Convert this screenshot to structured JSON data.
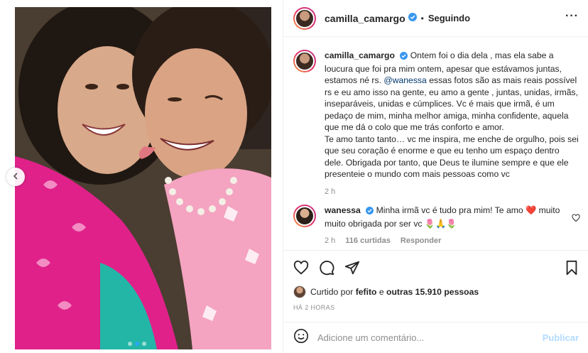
{
  "post": {
    "author": "camilla_camargo",
    "follow_status": "Seguindo",
    "separator": "•",
    "more_icon": "more-horizontal-icon"
  },
  "caption": {
    "username": "camilla_camargo",
    "text_1": "Ontem foi o dia dela , mas ela sabe a loucura que foi pra mim ontem, apesar que estávamos juntas, estamos né rs.",
    "mention": "@wanessa",
    "text_2": "essas fotos são as mais reais possível rs e eu amo isso na gente, eu amo a gente , juntas, unidas, irmãs, inseparáveis, unidas e cúmplices. Vc é mais que irmã, é um pedaço de mim, minha melhor amiga, minha confidente, aquela que me dá o colo que me trás conforto e amor.",
    "text_3": "Te amo tanto tanto… vc me inspira, me enche de orgulho, pois sei que seu coração é enorme e que eu tenho um espaço dentro dele. Obrigada por tanto, que Deus te ilumine sempre e que ele presenteie o mundo com mais pessoas como vc",
    "time": "2 h"
  },
  "reply": {
    "username": "wanessa",
    "text": "Minha irmã vc é tudo pra mim! Te amo ❤️ muito muito obrigada por ser vc 🌷🙏🌷",
    "time": "2 h",
    "likes": "116 curtidas",
    "reply_label": "Responder"
  },
  "likes": {
    "prefix": "Curtido por",
    "user": "fefito",
    "conj": "e",
    "others": "outras 15.910 pessoas"
  },
  "time_ago": "HÁ 2 HORAS",
  "composer": {
    "placeholder": "Adicione um comentário...",
    "post_label": "Publicar"
  },
  "colors": {
    "accent": "#0095f6",
    "verified": "#3897f0",
    "heart": "#ed4956",
    "post_disabled": "#b3dbff"
  }
}
